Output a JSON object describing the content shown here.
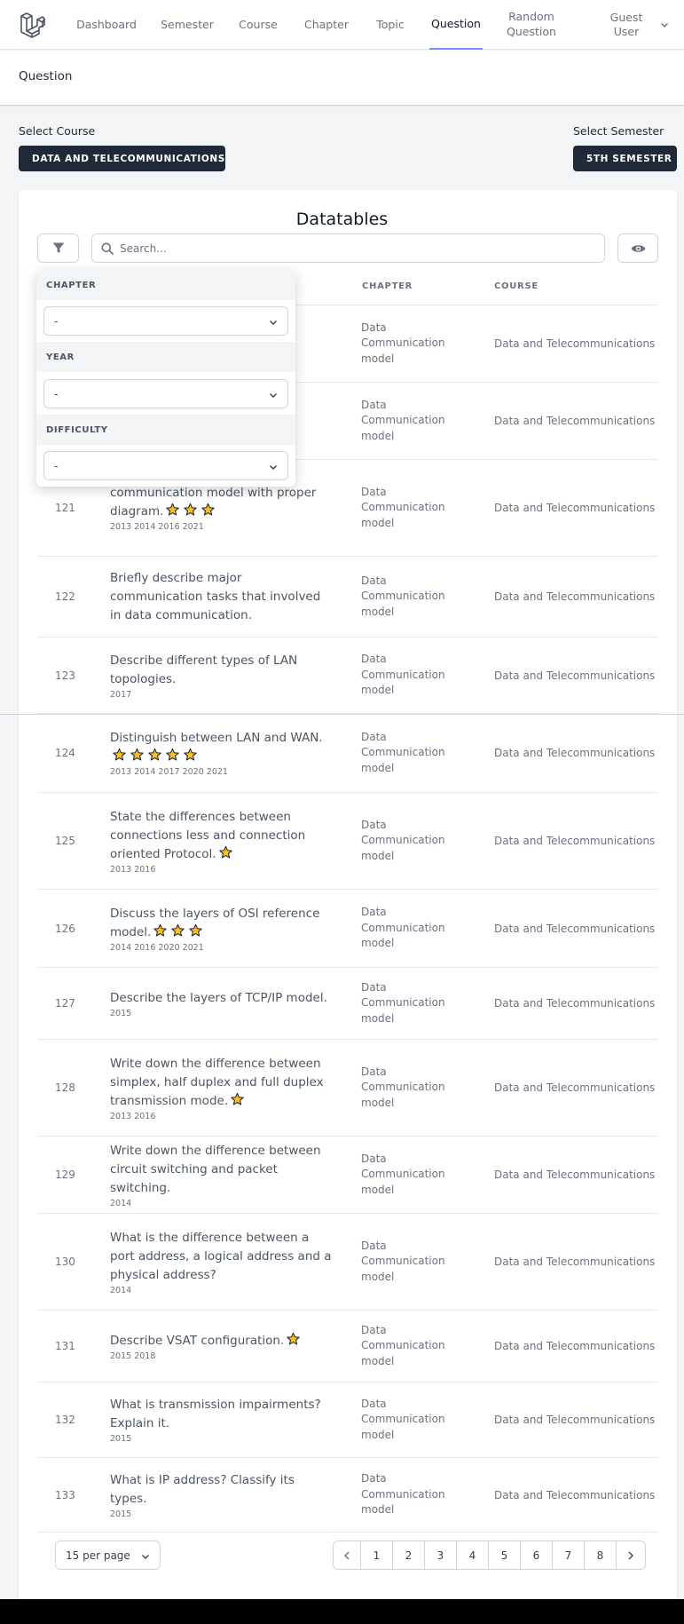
{
  "nav": {
    "links": [
      {
        "label": "Dashboard",
        "active": false
      },
      {
        "label": "Semester",
        "active": false
      },
      {
        "label": "Course",
        "active": false
      },
      {
        "label": "Chapter",
        "active": false
      },
      {
        "label": "Topic",
        "active": false
      },
      {
        "label": "Question",
        "active": true
      },
      {
        "label": "Random Question",
        "active": false
      }
    ],
    "user_name": "Guest User"
  },
  "page": {
    "title": "Question"
  },
  "selectors": {
    "course_label": "Select Course",
    "course_value": "DATA AND TELECOMMUNICATIONS",
    "semester_label": "Select Semester",
    "semester_value": "5TH SEMESTER"
  },
  "table": {
    "title": "Datatables",
    "search_placeholder": "Search...",
    "columns": {
      "chapter": "CHAPTER",
      "course": "COURSE"
    },
    "chapter_text": [
      "Data",
      "Communication",
      "model"
    ],
    "course_text": "Data and Telecommunications",
    "rows": [
      {
        "id": "",
        "question": "",
        "stars": 0,
        "years": ""
      },
      {
        "id": "",
        "question": "",
        "stars": 0,
        "years": ""
      },
      {
        "id": "121",
        "question": "communication model with proper diagram.",
        "question_top": "",
        "stars": 3,
        "years": "2013 2014 2016 2021"
      },
      {
        "id": "122",
        "question": "Briefly describe major communication tasks that involved in data communication.",
        "stars": 0,
        "years": ""
      },
      {
        "id": "123",
        "question": "Describe different types of LAN topologies.",
        "stars": 0,
        "years": "2017"
      },
      {
        "id": "124",
        "question": "Distinguish between LAN and WAN.",
        "stars": 5,
        "years": "2013 2014 2017 2020 2021"
      },
      {
        "id": "125",
        "question": "State the differences between connections less and connection oriented Protocol.",
        "stars": 1,
        "years": "2013 2016"
      },
      {
        "id": "126",
        "question": "Discuss the layers of OSI reference model.",
        "stars": 3,
        "years": "2014 2016 2020 2021"
      },
      {
        "id": "127",
        "question": "Describe the layers of TCP/IP model.",
        "stars": 0,
        "years": "2015"
      },
      {
        "id": "128",
        "question": "Write down the difference between simplex, half duplex and full duplex transmission mode.",
        "stars": 1,
        "years": "2013 2016"
      },
      {
        "id": "129",
        "question": "Write down the difference between circuit switching and packet switching.",
        "stars": 0,
        "years": "2014"
      },
      {
        "id": "130",
        "question": "What is the difference between a port address, a logical address and a physical address?",
        "stars": 0,
        "years": "2014"
      },
      {
        "id": "131",
        "question": "Describe VSAT configuration.",
        "stars": 1,
        "years": "2015 2018"
      },
      {
        "id": "132",
        "question": "What is transmission impairments? Explain it.",
        "stars": 0,
        "years": "2015"
      },
      {
        "id": "133",
        "question": "What is IP address? Classify its types.",
        "stars": 0,
        "years": "2015"
      }
    ]
  },
  "filters": {
    "chapter_label": "CHAPTER",
    "chapter_value": "-",
    "year_label": "YEAR",
    "year_value": "-",
    "difficulty_label": "DIFFICULTY",
    "difficulty_value": "-"
  },
  "pagination": {
    "per_page": "15 per page",
    "pages": [
      "1",
      "2",
      "3",
      "4",
      "5",
      "6",
      "7",
      "8"
    ],
    "prev": "‹",
    "next": "›"
  },
  "colors": {
    "accent": "#818cf8",
    "dark_button": "#1f2937",
    "star_fill": "#fbbf24"
  }
}
